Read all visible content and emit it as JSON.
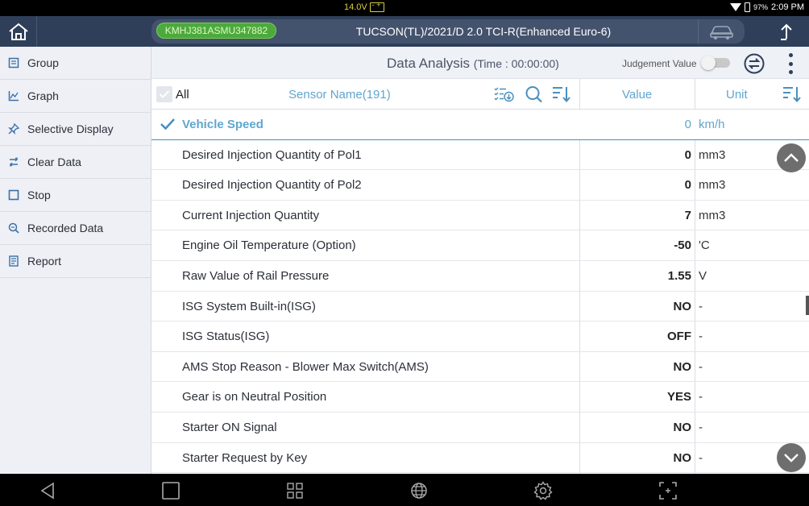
{
  "status": {
    "voltage": "14.0V",
    "battery_pct": "97%",
    "time": "2:09 PM"
  },
  "topbar": {
    "vin": "KMHJ381ASMU347882",
    "vehicle": "TUCSON(TL)/2021/D 2.0 TCI-R(Enhanced Euro-6)"
  },
  "sidebar": {
    "items": [
      {
        "label": "Group"
      },
      {
        "label": "Graph"
      },
      {
        "label": "Selective Display"
      },
      {
        "label": "Clear Data"
      },
      {
        "label": "Stop"
      },
      {
        "label": "Recorded Data"
      },
      {
        "label": "Report"
      }
    ]
  },
  "title": {
    "main": "Data Analysis",
    "time": "(Time : 00:00:00)",
    "judgement": "Judgement Value"
  },
  "header": {
    "all": "All",
    "sensor_name": "Sensor Name(191)",
    "value": "Value",
    "unit": "Unit"
  },
  "rows": [
    {
      "name": "Vehicle Speed",
      "value": "0",
      "unit": "km/h"
    },
    {
      "name": "Desired Injection Quantity of Pol1",
      "value": "0",
      "unit": "mm3"
    },
    {
      "name": "Desired Injection Quantity of Pol2",
      "value": "0",
      "unit": "mm3"
    },
    {
      "name": "Current Injection Quantity",
      "value": "7",
      "unit": "mm3"
    },
    {
      "name": "Engine Oil Temperature (Option)",
      "value": "-50",
      "unit": "'C"
    },
    {
      "name": "Raw Value of Rail Pressure",
      "value": "1.55",
      "unit": "V"
    },
    {
      "name": "ISG System Built-in(ISG)",
      "value": "NO",
      "unit": "-"
    },
    {
      "name": "ISG Status(ISG)",
      "value": "OFF",
      "unit": "-"
    },
    {
      "name": "AMS Stop Reason - Blower Max Switch(AMS)",
      "value": "NO",
      "unit": "-"
    },
    {
      "name": "Gear is on Neutral Position",
      "value": "YES",
      "unit": "-"
    },
    {
      "name": "Starter ON Signal",
      "value": "NO",
      "unit": "-"
    },
    {
      "name": "Starter Request by Key",
      "value": "NO",
      "unit": "-"
    }
  ],
  "colors": {
    "accent": "#5fa6cf",
    "topbar": "#2f3f5a",
    "vin_badge": "#4caa3c"
  }
}
